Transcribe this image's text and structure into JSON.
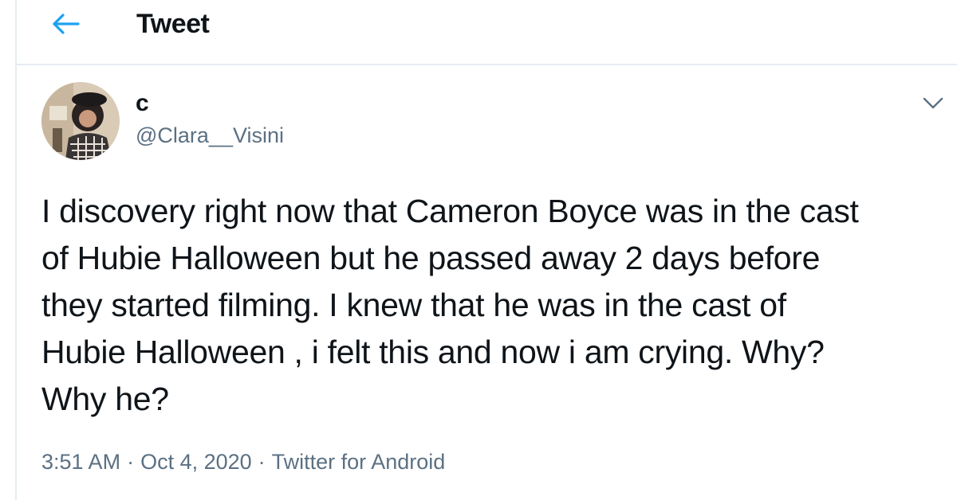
{
  "header": {
    "title": "Tweet",
    "back_icon": "arrow-left-icon",
    "accent_color": "#1da1f2"
  },
  "author": {
    "display_name": "c",
    "handle": "@Clara__Visini",
    "avatar_icon": "avatar-photo"
  },
  "tweet": {
    "text": "I discovery right now that Cameron Boyce was in the cast\nof Hubie Halloween but he passed away 2 days before\nthey started filming. I knew that he was in the cast of\nHubie Halloween , i felt this and now i am crying. Why?\nWhy he?",
    "more_icon": "chevron-down-icon"
  },
  "meta": {
    "time": "3:51 AM",
    "date": "Oct 4, 2020",
    "source": "Twitter for Android",
    "separator": "·"
  }
}
